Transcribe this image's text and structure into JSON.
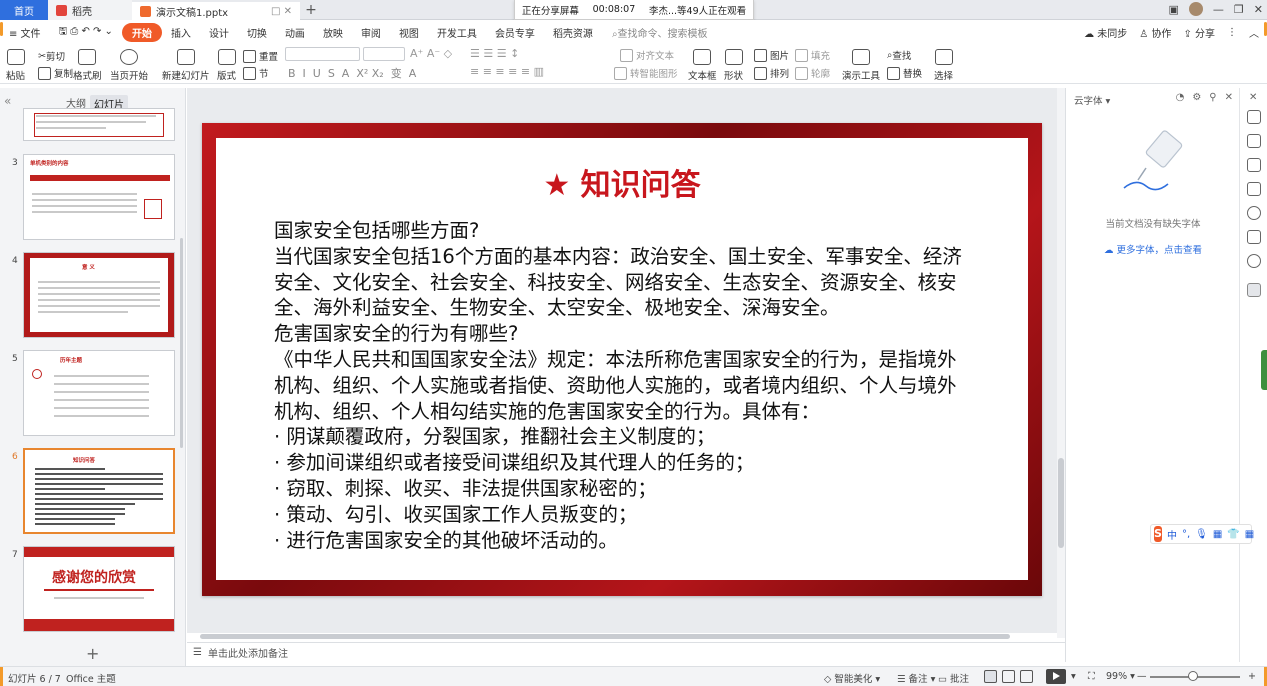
{
  "tabs": {
    "home": "首页",
    "daoke": "稻壳",
    "doc": "演示文稿1.pptx",
    "add": "+"
  },
  "share_banner": {
    "status": "正在分享屏幕",
    "time": "00:08:07",
    "viewers": "李杰...等49人正在观看"
  },
  "menu": {
    "file": "≡ 文件",
    "items": [
      "开始",
      "插入",
      "设计",
      "切换",
      "动画",
      "放映",
      "审阅",
      "视图",
      "开发工具",
      "会员专享",
      "稻壳资源"
    ],
    "active_index": 0,
    "search": "查找命令、搜索模板",
    "right": [
      "未同步",
      "协作",
      "分享"
    ]
  },
  "ribbon": {
    "paste": "粘贴",
    "cut": "剪切",
    "copy": "复制",
    "format_painter": "格式刷",
    "from_start": "当页开始",
    "new_slide": "新建幻灯片",
    "layout": "版式",
    "section": "节",
    "reset": "重置",
    "text_box": "文本框",
    "shape": "形状",
    "arrange": "排列",
    "picture": "图片",
    "fill": "填充",
    "outline": "轮廓",
    "present_tools": "演示工具",
    "find": "查找",
    "replace": "替换",
    "select": "选择",
    "align_text": "对齐文本",
    "smartart": "转智能图形"
  },
  "left_panel": {
    "tab_outline": "大纲",
    "tab_slides": "幻灯片",
    "thumbnails": [
      {
        "num": "3",
        "title": "单机类别的内容"
      },
      {
        "num": "4",
        "title": "意 义"
      },
      {
        "num": "5",
        "title": "历年主题"
      },
      {
        "num": "6",
        "title": "知识问答",
        "active": true
      },
      {
        "num": "7",
        "title": "感谢您的欣赏"
      }
    ],
    "add": "+"
  },
  "slide": {
    "title": "★ 知识问答",
    "lines": [
      "国家安全包括哪些方面?",
      "当代国家安全包括16个方面的基本内容：政治安全、国土安全、军事安全、经济安全、文化安全、社会安全、科技安全、网络安全、生态安全、资源安全、核安全、海外利益安全、生物安全、太空安全、极地安全、深海安全。",
      "危害国家安全的行为有哪些?",
      "《中华人民共和国国家安全法》规定：本法所称危害国家安全的行为，是指境外机构、组织、个人实施或者指使、资助他人实施的，或者境内组织、个人与境外机构、组织、个人相勾结实施的危害国家安全的行为。具体有：",
      "· 阴谋颠覆政府，分裂国家，推翻社会主义制度的；",
      "· 参加间谍组织或者接受间谍组织及其代理人的任务的；",
      "· 窃取、刺探、收买、非法提供国家秘密的；",
      "· 策动、勾引、收买国家工作人员叛变的；",
      "· 进行危害国家安全的其他破坏活动的。"
    ]
  },
  "notes_placeholder": "单击此处添加备注",
  "right_panel": {
    "header": "云字体",
    "empty": "当前文档没有缺失字体",
    "link": "更多字体，点击查看"
  },
  "status": {
    "slide_counter": "幻灯片 6 / 7",
    "theme": "Office 主题",
    "beautify": "智能美化",
    "notes": "备注",
    "comments": "批注",
    "zoom": "99%"
  },
  "colors": {
    "accent": "#f05a28",
    "slide_red": "#c8161d",
    "home_tab": "#2f6fde"
  }
}
